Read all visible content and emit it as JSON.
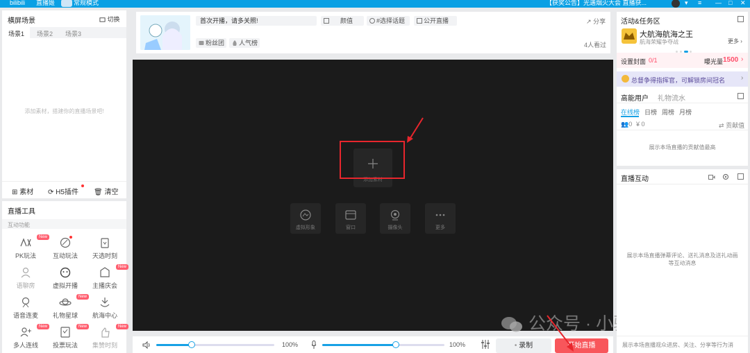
{
  "topbar": {
    "app_name": "直播姬",
    "mode": "常规模式",
    "announcement": "【获奖公告】光遇烟火大会 直播获..."
  },
  "scenes": {
    "title": "横屏场景",
    "switch_label": "切换",
    "tabs": [
      "场景1",
      "场景2",
      "场景3"
    ],
    "empty_hint": "添加素材，搭建你的直播场景吧!",
    "actions": {
      "material": "素材",
      "h5": "H5插件",
      "clear": "清空"
    }
  },
  "tools": {
    "title": "直播工具",
    "section": "互动功能",
    "items": [
      {
        "label": "PK玩法",
        "new": true
      },
      {
        "label": "互动玩法",
        "dot": true
      },
      {
        "label": "天选时刻"
      },
      {
        "label": "语聊房"
      },
      {
        "label": "虚拟开播"
      },
      {
        "label": "主播庆会",
        "new": true
      },
      {
        "label": "语音连麦"
      },
      {
        "label": "礼物星球",
        "new": true
      },
      {
        "label": "航海中心"
      },
      {
        "label": "多人连线",
        "new": true
      },
      {
        "label": "投票玩法",
        "new": true
      },
      {
        "label": "集赞时刻",
        "new": true
      }
    ],
    "new_label": "New"
  },
  "stream": {
    "title_input": "首次开播，请多关照!",
    "chips": {
      "appearance": "颜值",
      "topic": "#选择话题",
      "public": "公开直播",
      "fans": "粉丝团",
      "popularity": "人气榜"
    },
    "share": "分享",
    "viewers": "4人看过"
  },
  "preview": {
    "add_label": "添加素材",
    "tiles": [
      "虚拟形象",
      "窗口",
      "摄像头",
      "更多"
    ]
  },
  "bottombar": {
    "speaker_volume": "100%",
    "mic_volume": "100%",
    "speaker_level": 0.3,
    "mic_level": 0.6,
    "record": "录制",
    "start": "开始直播"
  },
  "watermark": "公众号 · 小驰成长圈",
  "activity": {
    "title": "活动&任务区",
    "event_name": "大航海航海之王",
    "event_sub": "航海荣耀争夺战",
    "more": "更多",
    "cover_label": "设置封面",
    "cover_count": "0/1",
    "exposure_label": "曝光量",
    "exposure_value": "1500",
    "banner": "总督争得指挥官，可解锁房间冠名"
  },
  "ranking": {
    "tabs": [
      "高能用户",
      "礼物流水"
    ],
    "subtabs": [
      "在线榜",
      "日榜",
      "周榜",
      "月榜"
    ],
    "count_users": "0",
    "count_coins": "0",
    "contribution": "贡献值",
    "empty": "展示本场直播的贡献值最高"
  },
  "interaction": {
    "title": "直播互动",
    "empty_line1": "展示本场直播弹幕评论、送礼消息及送礼动画",
    "empty_line2": "等互动消息",
    "footer": "展示本场直播观众进房、关注、分享等行为消"
  },
  "colors": {
    "topbar": "#0aa0e4",
    "accent_blue": "#17a1e5",
    "start_button": "#f8565b",
    "exposure": "#ff4d6a",
    "preview_bg": "#1b1b1b",
    "annotation": "#e8262d"
  }
}
